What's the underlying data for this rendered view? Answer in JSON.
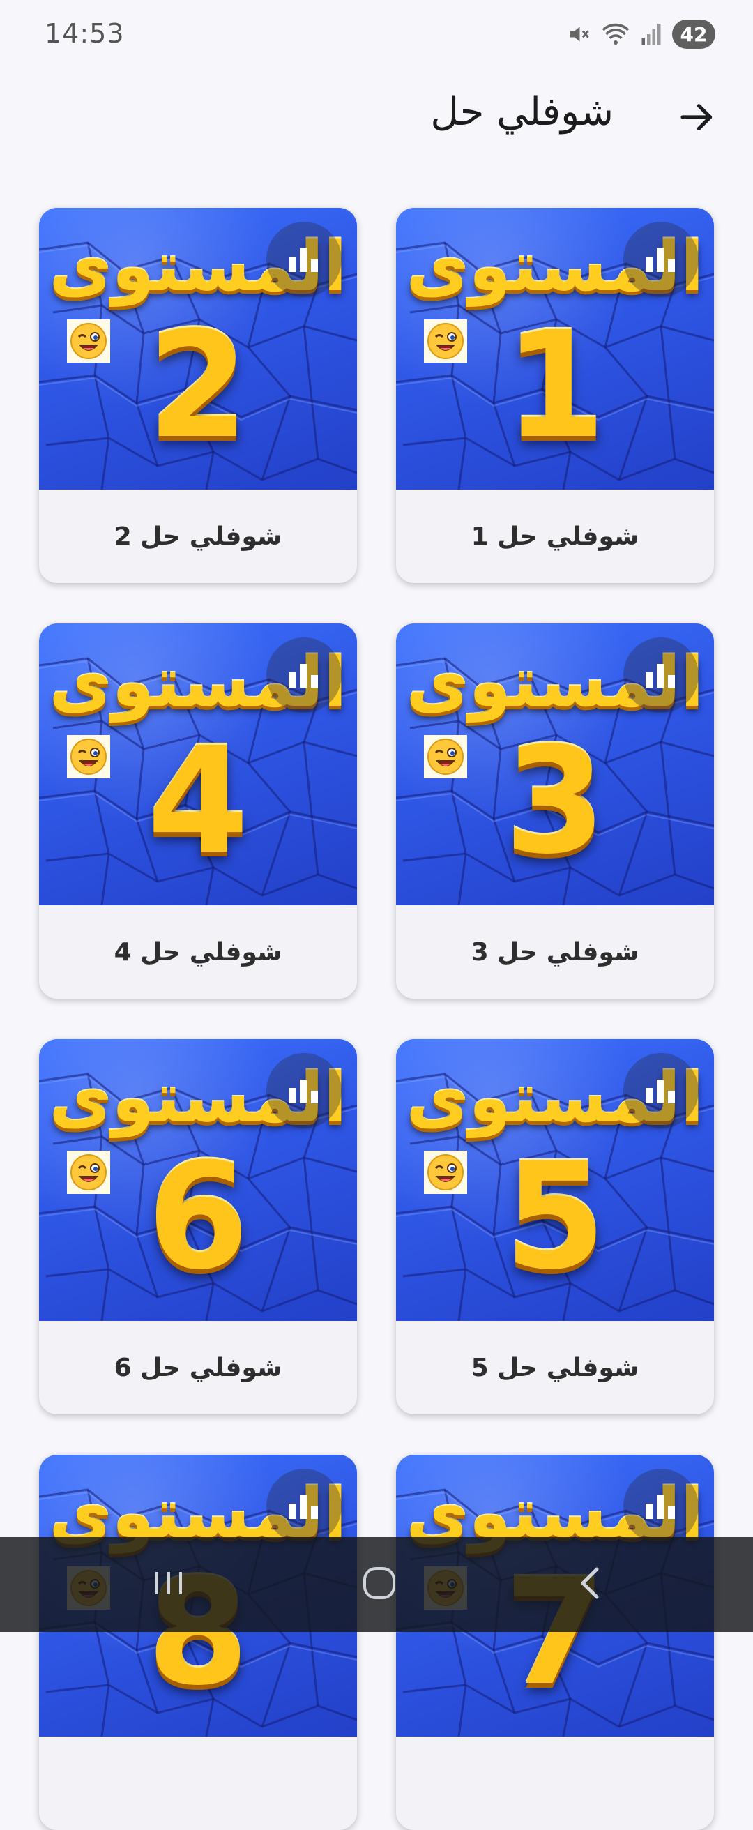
{
  "status_bar": {
    "time": "14:53",
    "battery": "42"
  },
  "header": {
    "title": "شوفلي حل",
    "back_icon": "arrow-right-icon"
  },
  "level_word": "المستوى",
  "cards": [
    {
      "number": "1",
      "caption": "شوفلي حل 1"
    },
    {
      "number": "2",
      "caption": "شوفلي حل 2"
    },
    {
      "number": "3",
      "caption": "شوفلي حل 3"
    },
    {
      "number": "4",
      "caption": "شوفلي حل 4"
    },
    {
      "number": "5",
      "caption": "شوفلي حل 5"
    },
    {
      "number": "6",
      "caption": "شوفلي حل 6"
    },
    {
      "number": "7",
      "caption": ""
    },
    {
      "number": "8",
      "caption": ""
    }
  ],
  "nav": {
    "recents_icon": "recents-icon",
    "home_icon": "home-icon",
    "back_icon": "back-icon"
  },
  "colors": {
    "tile_blue": "#2f57e6",
    "gold": "#ffc51a",
    "background": "#f6f6fb"
  }
}
